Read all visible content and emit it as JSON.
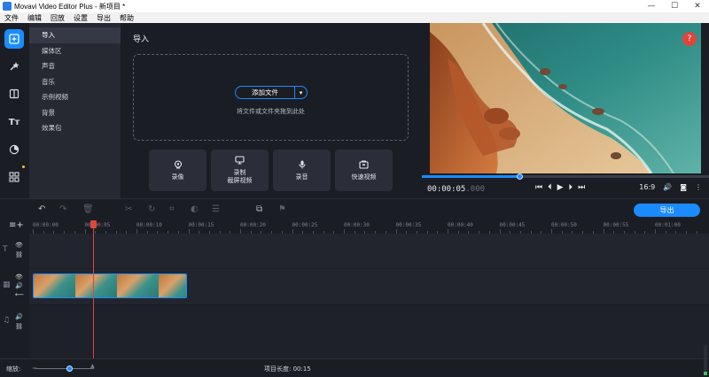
{
  "window": {
    "title": "Movavi Video Editor Plus - 新项目 *",
    "controls": [
      "—",
      "☐",
      "✕"
    ]
  },
  "menu": [
    "文件",
    "编辑",
    "回放",
    "设置",
    "导出",
    "帮助"
  ],
  "categories": [
    {
      "label": "导入",
      "active": true
    },
    {
      "label": "媒体区"
    },
    {
      "label": "声音"
    },
    {
      "label": "音乐"
    },
    {
      "label": "示例视频"
    },
    {
      "label": "背景"
    },
    {
      "label": "效果包"
    }
  ],
  "import_panel": {
    "heading": "导入",
    "add_files": "添加文件",
    "drop_hint": "将文件或文件夹拖到此处",
    "tools": [
      {
        "label": "录像",
        "icon": "webcam-icon"
      },
      {
        "label": "录制\n截屏视频",
        "icon": "screen-record-icon"
      },
      {
        "label": "录音",
        "icon": "microphone-icon"
      },
      {
        "label": "快速视频",
        "icon": "quick-video-icon"
      }
    ]
  },
  "player": {
    "timecode": "00:00:05",
    "timecode_ms": ".000",
    "progress": 0.34,
    "aspect": "16:9",
    "help": "?"
  },
  "toolbar": {
    "export_label": "导出"
  },
  "ruler": {
    "ticks": [
      "00:00:00",
      "00:00:05",
      "00:00:10",
      "00:00:15",
      "00:00:20",
      "00:00:25",
      "00:00:30",
      "00:00:35",
      "00:00:40",
      "00:00:45",
      "00:00:50",
      "00:00:55",
      "00:01:00"
    ]
  },
  "status": {
    "zoom_label": "缩放:",
    "duration": "项目长度: 00:15"
  },
  "colors": {
    "accent": "#1a8cff",
    "playhead": "#e0453b",
    "help": "#e0453b"
  }
}
